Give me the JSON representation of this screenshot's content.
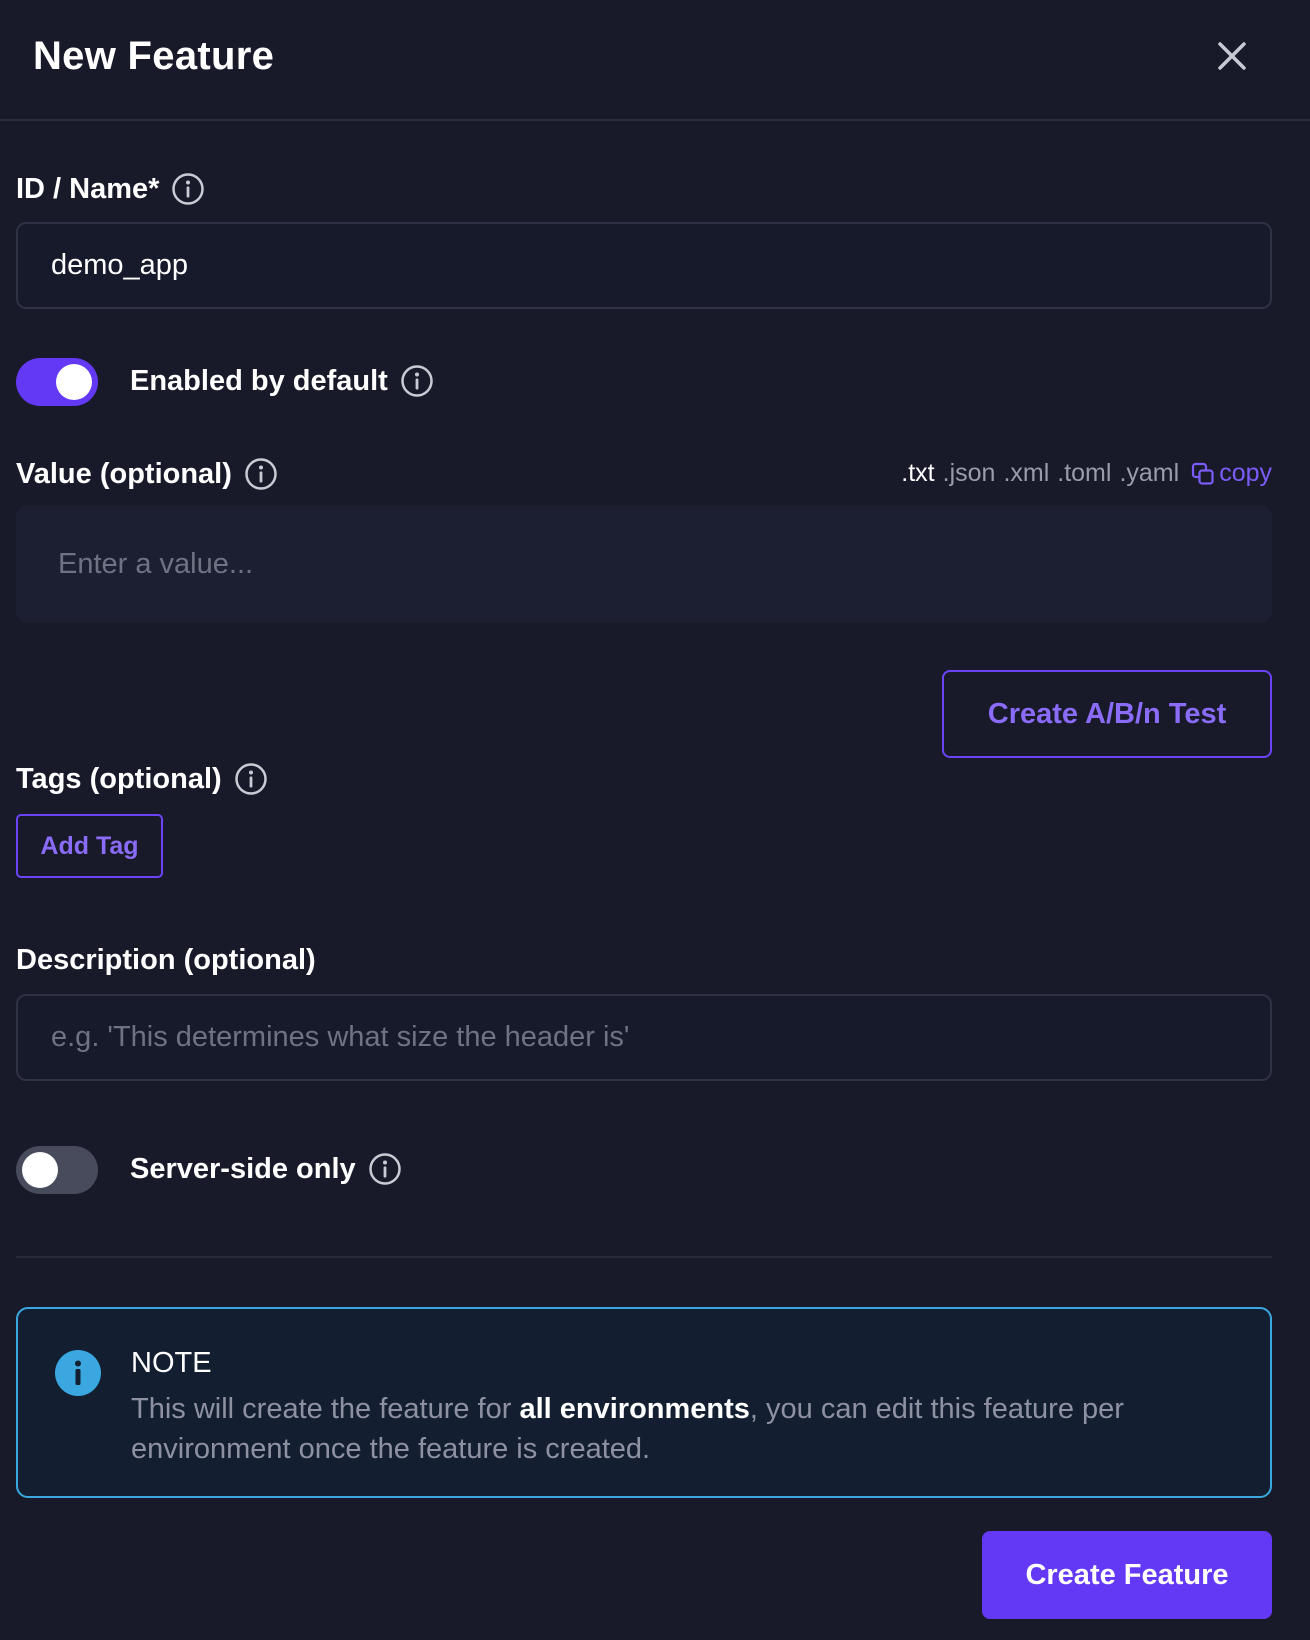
{
  "header": {
    "title": "New Feature"
  },
  "fields": {
    "id_name": {
      "label": "ID / Name*",
      "value": "demo_app"
    },
    "enabled_default": {
      "label": "Enabled by default",
      "on": true
    },
    "value": {
      "label": "Value (optional)",
      "placeholder": "Enter a value...",
      "formats": [
        ".txt",
        ".json",
        ".xml",
        ".toml",
        ".yaml"
      ],
      "active_format": ".txt",
      "copy_label": "copy"
    },
    "ab_button": "Create A/B/n Test",
    "tags": {
      "label": "Tags (optional)",
      "add_button": "Add Tag"
    },
    "description": {
      "label": "Description (optional)",
      "placeholder": "e.g. 'This determines what size the header is'"
    },
    "server_side": {
      "label": "Server-side only",
      "on": false
    }
  },
  "note": {
    "title": "NOTE",
    "text_before": "This will create the feature for ",
    "text_bold": "all environments",
    "text_after": ", you can edit this feature per environment once the feature is created."
  },
  "footer": {
    "create_button": "Create Feature"
  },
  "colors": {
    "background": "#181a2a",
    "accent": "#6439f5",
    "info": "#3aa7e0"
  }
}
